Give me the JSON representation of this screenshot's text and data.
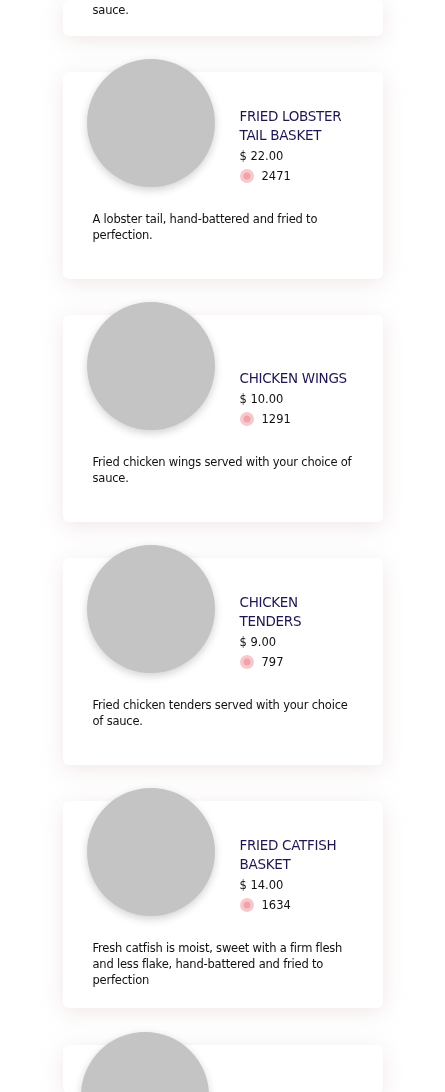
{
  "top_card": {
    "description": "sauce."
  },
  "items": [
    {
      "name": "FRIED LOBSTER TAIL BASKET",
      "price": "$ 22.00",
      "likes": "2471",
      "description": "A lobster tail, hand-battered and fried to perfection."
    },
    {
      "name": "CHICKEN WINGS",
      "price": "$ 10.00",
      "likes": "1291",
      "description": "Fried chicken wings served with your choice of sauce."
    },
    {
      "name": "CHICKEN TENDERS",
      "price": "$ 9.00",
      "likes": "797",
      "description": "Fried chicken tenders served with your choice of sauce."
    },
    {
      "name": "FRIED CATFISH BASKET",
      "price": "$ 14.00",
      "likes": "1634",
      "description": "Fresh catfish is moist, sweet with a firm flesh and less flake, hand-battered and fried to perfection"
    }
  ],
  "more_below": true
}
